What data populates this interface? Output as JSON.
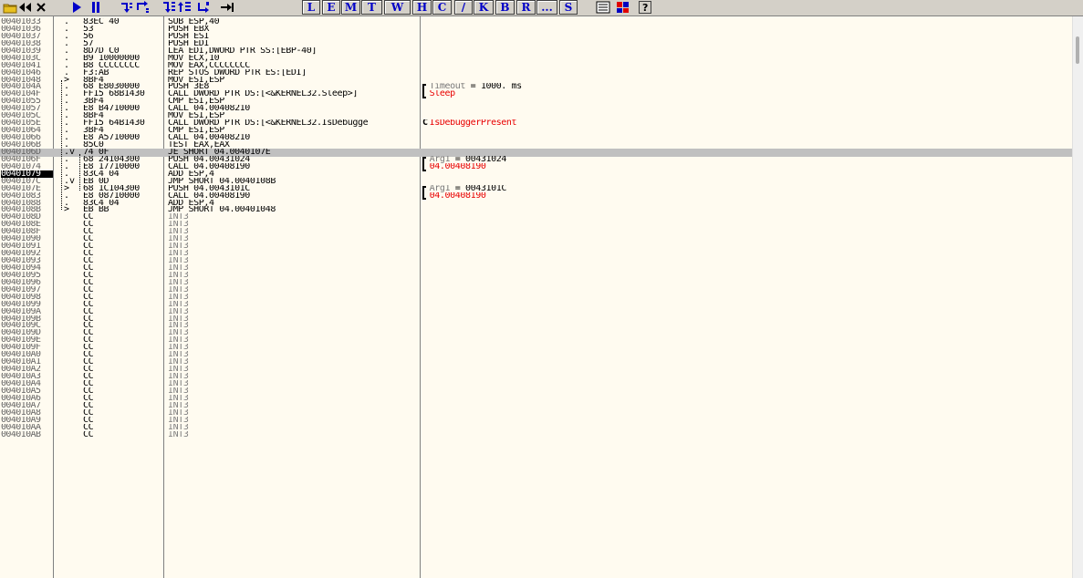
{
  "toolbar": {
    "buttons": [
      {
        "name": "open-icon",
        "label": ""
      },
      {
        "name": "restart-icon",
        "label": ""
      },
      {
        "name": "close-icon",
        "label": ""
      },
      {
        "name": "run-icon",
        "label": ""
      },
      {
        "name": "pause-icon",
        "label": ""
      },
      {
        "name": "step-into-icon",
        "label": ""
      },
      {
        "name": "step-over-icon",
        "label": ""
      },
      {
        "name": "trace-into-icon",
        "label": ""
      },
      {
        "name": "trace-over-icon",
        "label": ""
      },
      {
        "name": "execute-till-return-icon",
        "label": ""
      },
      {
        "name": "go-to-icon",
        "label": ""
      }
    ],
    "letters": [
      "L",
      "E",
      "M",
      "T",
      "W",
      "H",
      "C",
      "/",
      "K",
      "B",
      "R",
      "...",
      "S"
    ],
    "extra_icons": [
      "list-icon",
      "grid-icon",
      "help-icon"
    ],
    "colors": {
      "letter_text": "#0000c8",
      "icon_blue": "#0000c8"
    }
  },
  "disasm": {
    "rows": [
      {
        "addr": "00401033",
        "mark": ".",
        "hex": "83EC 40",
        "asm": "SUB ESP,40"
      },
      {
        "addr": "00401036",
        "mark": ".",
        "hex": "53",
        "asm": "PUSH EBX"
      },
      {
        "addr": "00401037",
        "mark": ".",
        "hex": "56",
        "asm": "PUSH ESI"
      },
      {
        "addr": "00401038",
        "mark": ".",
        "hex": "57",
        "asm": "PUSH EDI"
      },
      {
        "addr": "00401039",
        "mark": ".",
        "hex": "8D7D C0",
        "asm": "LEA EDI,DWORD PTR SS:[EBP-40]"
      },
      {
        "addr": "0040103C",
        "mark": ".",
        "hex": "B9 10000000",
        "asm": "MOV ECX,10"
      },
      {
        "addr": "00401041",
        "mark": ".",
        "hex": "B8 CCCCCCCC",
        "asm": "MOV EAX,CCCCCCCC"
      },
      {
        "addr": "00401046",
        "mark": ".",
        "hex": "F3:AB",
        "asm": "REP STOS DWORD PTR ES:[EDI]"
      },
      {
        "addr": "00401048",
        "mark": ">",
        "hex": "8BF4",
        "asm": "MOV ESI,ESP"
      },
      {
        "addr": "0040104A",
        "mark": ".",
        "hex": "68 E8030000",
        "asm": "PUSH 3E8",
        "cmt_prefix": "Timeout",
        "cmt_value": " = 1000. ms",
        "bracket": "top"
      },
      {
        "addr": "0040104F",
        "mark": ".",
        "hex": "FF15 68B1430",
        "asm": "CALL DWORD PTR DS:[<&KERNEL32.Sleep>]",
        "cmt_red": "Sleep",
        "bracket": "bottom"
      },
      {
        "addr": "00401055",
        "mark": ".",
        "hex": "3BF4",
        "asm": "CMP ESI,ESP"
      },
      {
        "addr": "00401057",
        "mark": ".",
        "hex": "E8 B4710000",
        "asm": "CALL 04.00408210"
      },
      {
        "addr": "0040105C",
        "mark": ".",
        "hex": "8BF4",
        "asm": "MOV ESI,ESP"
      },
      {
        "addr": "0040105E",
        "mark": ".",
        "hex": "FF15 64B1430",
        "asm": "CALL DWORD PTR DS:[<&KERNEL32.IsDebugge",
        "cmt_red": "IsDebuggerPresent",
        "bracket": "single"
      },
      {
        "addr": "00401064",
        "mark": ".",
        "hex": "3BF4",
        "asm": "CMP ESI,ESP"
      },
      {
        "addr": "00401066",
        "mark": ".",
        "hex": "E8 A5710000",
        "asm": "CALL 04.00408210"
      },
      {
        "addr": "0040106B",
        "mark": ".",
        "hex": "85C0",
        "asm": "TEST EAX,EAX"
      },
      {
        "addr": "0040106D",
        "mark": ".v",
        "hex": "74 0F",
        "asm": "JE SHORT 04.0040107E",
        "selected": true
      },
      {
        "addr": "0040106F",
        "mark": ".",
        "hex": "68 24104300",
        "asm": "PUSH 04.00431024",
        "cmt_prefix": "Arg1",
        "cmt_value": " = 00431024",
        "bracket": "top"
      },
      {
        "addr": "00401074",
        "mark": ".",
        "hex": "E8 17710000",
        "asm": "CALL 04.00408190",
        "cmt_red": "04.00408190",
        "bracket": "bottom"
      },
      {
        "addr": "00401079",
        "mark": ".",
        "hex": "83C4 04",
        "asm": "ADD ESP,4",
        "current": true
      },
      {
        "addr": "0040107C",
        "mark": ".v",
        "hex": "EB 0D",
        "asm": "JMP SHORT 04.0040108B"
      },
      {
        "addr": "0040107E",
        "mark": ">",
        "hex": "68 1C104300",
        "asm": "PUSH 04.0043101C",
        "cmt_prefix": "Arg1",
        "cmt_value": " = 0043101C",
        "bracket": "top"
      },
      {
        "addr": "00401083",
        "mark": ".",
        "hex": "E8 08710000",
        "asm": "CALL 04.00408190",
        "cmt_red": "04.00408190",
        "bracket": "bottom"
      },
      {
        "addr": "00401088",
        "mark": ".",
        "hex": "83C4 04",
        "asm": "ADD ESP,4"
      },
      {
        "addr": "0040108B",
        "mark": ">",
        "hex": "EB BB",
        "asm": "JMP SHORT 04.00401048"
      },
      {
        "addr": "0040108D",
        "mark": "",
        "hex": "CC",
        "asm": "INT3",
        "int3": true
      },
      {
        "addr": "0040108E",
        "mark": "",
        "hex": "CC",
        "asm": "INT3",
        "int3": true
      },
      {
        "addr": "0040108F",
        "mark": "",
        "hex": "CC",
        "asm": "INT3",
        "int3": true
      },
      {
        "addr": "00401090",
        "mark": "",
        "hex": "CC",
        "asm": "INT3",
        "int3": true
      },
      {
        "addr": "00401091",
        "mark": "",
        "hex": "CC",
        "asm": "INT3",
        "int3": true
      },
      {
        "addr": "00401092",
        "mark": "",
        "hex": "CC",
        "asm": "INT3",
        "int3": true
      },
      {
        "addr": "00401093",
        "mark": "",
        "hex": "CC",
        "asm": "INT3",
        "int3": true
      },
      {
        "addr": "00401094",
        "mark": "",
        "hex": "CC",
        "asm": "INT3",
        "int3": true
      },
      {
        "addr": "00401095",
        "mark": "",
        "hex": "CC",
        "asm": "INT3",
        "int3": true
      },
      {
        "addr": "00401096",
        "mark": "",
        "hex": "CC",
        "asm": "INT3",
        "int3": true
      },
      {
        "addr": "00401097",
        "mark": "",
        "hex": "CC",
        "asm": "INT3",
        "int3": true
      },
      {
        "addr": "00401098",
        "mark": "",
        "hex": "CC",
        "asm": "INT3",
        "int3": true
      },
      {
        "addr": "00401099",
        "mark": "",
        "hex": "CC",
        "asm": "INT3",
        "int3": true
      },
      {
        "addr": "0040109A",
        "mark": "",
        "hex": "CC",
        "asm": "INT3",
        "int3": true
      },
      {
        "addr": "0040109B",
        "mark": "",
        "hex": "CC",
        "asm": "INT3",
        "int3": true
      },
      {
        "addr": "0040109C",
        "mark": "",
        "hex": "CC",
        "asm": "INT3",
        "int3": true
      },
      {
        "addr": "0040109D",
        "mark": "",
        "hex": "CC",
        "asm": "INT3",
        "int3": true
      },
      {
        "addr": "0040109E",
        "mark": "",
        "hex": "CC",
        "asm": "INT3",
        "int3": true
      },
      {
        "addr": "0040109F",
        "mark": "",
        "hex": "CC",
        "asm": "INT3",
        "int3": true
      },
      {
        "addr": "004010A0",
        "mark": "",
        "hex": "CC",
        "asm": "INT3",
        "int3": true
      },
      {
        "addr": "004010A1",
        "mark": "",
        "hex": "CC",
        "asm": "INT3",
        "int3": true
      },
      {
        "addr": "004010A2",
        "mark": "",
        "hex": "CC",
        "asm": "INT3",
        "int3": true
      },
      {
        "addr": "004010A3",
        "mark": "",
        "hex": "CC",
        "asm": "INT3",
        "int3": true
      },
      {
        "addr": "004010A4",
        "mark": "",
        "hex": "CC",
        "asm": "INT3",
        "int3": true
      },
      {
        "addr": "004010A5",
        "mark": "",
        "hex": "CC",
        "asm": "INT3",
        "int3": true
      },
      {
        "addr": "004010A6",
        "mark": "",
        "hex": "CC",
        "asm": "INT3",
        "int3": true
      },
      {
        "addr": "004010A7",
        "mark": "",
        "hex": "CC",
        "asm": "INT3",
        "int3": true
      },
      {
        "addr": "004010A8",
        "mark": "",
        "hex": "CC",
        "asm": "INT3",
        "int3": true
      },
      {
        "addr": "004010A9",
        "mark": "",
        "hex": "CC",
        "asm": "INT3",
        "int3": true
      },
      {
        "addr": "004010AA",
        "mark": "",
        "hex": "CC",
        "asm": "INT3",
        "int3": true
      },
      {
        "addr": "004010AB",
        "mark": "",
        "hex": "CC",
        "asm": "INT3",
        "int3": true
      }
    ],
    "colors": {
      "comment_red": "#e80000",
      "address_gray": "#646464",
      "selection": "#c0c0c0",
      "current_bg": "#000000"
    }
  }
}
